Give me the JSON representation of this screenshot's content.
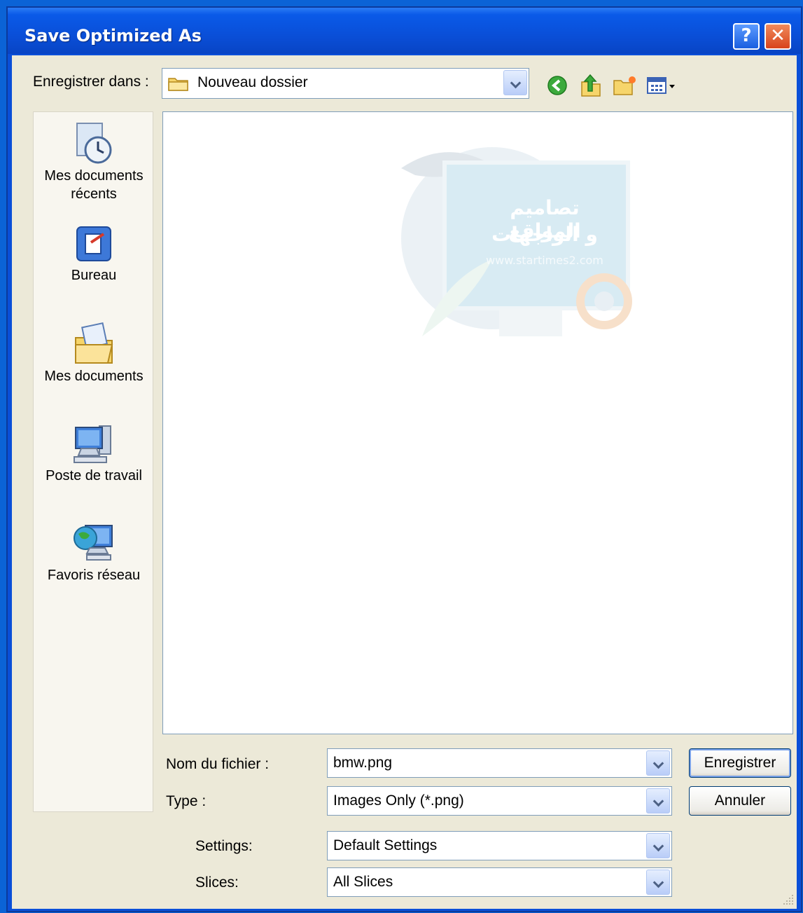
{
  "window": {
    "title": "Save Optimized As",
    "help_label": "?",
    "close_label": "✕"
  },
  "location": {
    "label": "Enregistrer dans :",
    "folder": "Nouveau dossier"
  },
  "toolbar": {
    "icons": [
      "back-icon",
      "up-folder-icon",
      "new-folder-icon",
      "view-menu-icon"
    ]
  },
  "places": [
    {
      "label_line1": "Mes documents",
      "label_line2": "récents",
      "icon": "recent-documents-icon"
    },
    {
      "label_line1": "Bureau",
      "label_line2": "",
      "icon": "desktop-icon"
    },
    {
      "label_line1": "Mes documents",
      "label_line2": "",
      "icon": "my-documents-icon"
    },
    {
      "label_line1": "Poste de travail",
      "label_line2": "",
      "icon": "my-computer-icon"
    },
    {
      "label_line1": "Favoris réseau",
      "label_line2": "",
      "icon": "network-places-icon"
    }
  ],
  "watermark": {
    "arabic_line1": "تصاميم المواقع",
    "arabic_line2": "و الواجهات",
    "site": "www.startimes2.com"
  },
  "form": {
    "filename_label": "Nom du fichier :",
    "filename_value": "bmw.png",
    "type_label": "Type :",
    "type_value": "Images Only (*.png)",
    "settings_label": "Settings:",
    "settings_value": "Default Settings",
    "slices_label": "Slices:",
    "slices_value": "All Slices"
  },
  "buttons": {
    "save": "Enregistrer",
    "cancel": "Annuler"
  },
  "colors": {
    "titlebar": "#0a4fd8",
    "dialog_bg": "#ece9d8"
  }
}
